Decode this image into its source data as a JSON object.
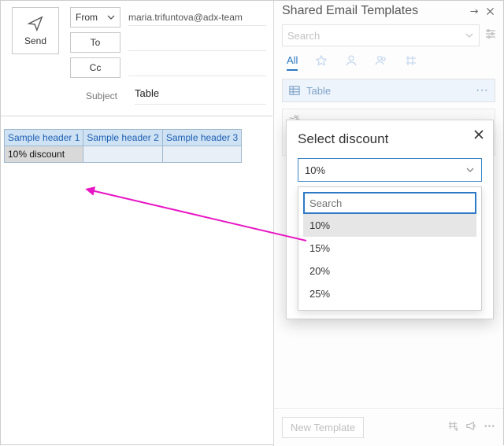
{
  "compose": {
    "send_label": "Send",
    "from_label": "From",
    "to_label": "To",
    "cc_label": "Cc",
    "from_value": "maria.trifuntova@adx-team",
    "subject_label": "Subject",
    "subject_value": "Table"
  },
  "table": {
    "headers": [
      "Sample header 1",
      "Sample header 2",
      "Sample header 3"
    ],
    "rows": [
      [
        "10% discount",
        "",
        ""
      ]
    ]
  },
  "panel": {
    "title": "Shared Email Templates",
    "search_placeholder": "Search",
    "filter_all": "All",
    "template_item_label": "Table",
    "code_preview": "~%\ndi                               ct\ndi",
    "new_template_label": "New Template"
  },
  "popup": {
    "title": "Select discount",
    "selected": "10%",
    "search_placeholder": "Search",
    "options": [
      "10%",
      "15%",
      "20%",
      "25%"
    ]
  }
}
